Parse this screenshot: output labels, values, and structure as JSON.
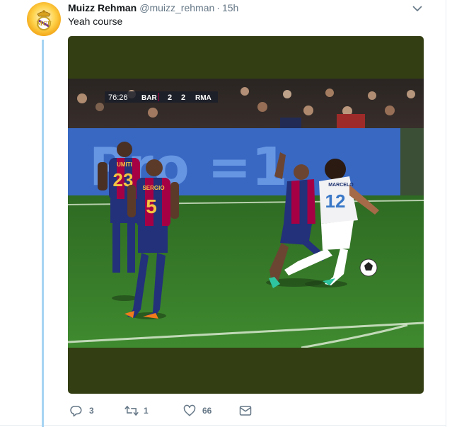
{
  "tweet": {
    "author_name": "Muizz Rehman",
    "handle": "@muizz_rehman",
    "separator": "·",
    "time": "15h",
    "text": "Yeah course"
  },
  "media": {
    "scoreboard": {
      "clock": "76:26",
      "home_team": "BAR",
      "home_score": "2",
      "away_score": "2",
      "away_team": "RMA"
    },
    "board_text": "Pro =1",
    "players": [
      {
        "name": "UMITI",
        "number": "23"
      },
      {
        "name": "SERGIO",
        "number": "5"
      },
      {
        "name": "MARCELO",
        "number": "12"
      }
    ]
  },
  "actions": {
    "replies": "3",
    "retweets": "1",
    "likes": "66"
  },
  "colors": {
    "accent": "#1da1f2",
    "thread_line": "#a6d4f2",
    "secondary_text": "#657786",
    "media_letterbox": "#333e13",
    "barca_blue": "#23307a",
    "barca_red": "#a50044",
    "pitch_green": "#3f7d2c"
  },
  "icons": [
    "real-madrid-crest-icon",
    "chevron-down-icon",
    "reply-icon",
    "retweet-icon",
    "heart-icon",
    "envelope-icon"
  ]
}
